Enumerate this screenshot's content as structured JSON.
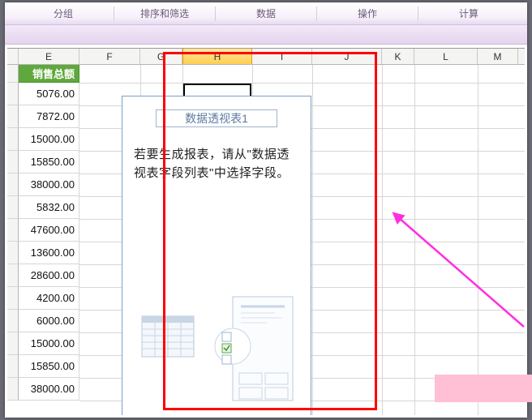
{
  "ribbon": {
    "items": [
      "分组",
      "排序和筛选",
      "数据",
      "操作",
      "计算"
    ]
  },
  "columns": [
    "E",
    "F",
    "G",
    "H",
    "I",
    "J",
    "K",
    "L",
    "M"
  ],
  "active_column": "H",
  "sales_header": "销售总额",
  "sales_values": [
    "5076.00",
    "7872.00",
    "15000.00",
    "15850.00",
    "38000.00",
    "5832.00",
    "47600.00",
    "13600.00",
    "28600.00",
    "4200.00",
    "6000.00",
    "15000.00",
    "15850.00",
    "38000.00"
  ],
  "pivot": {
    "title": "数据透视表1",
    "hint": "若要生成报表，请从\"数据透视表字段列表\"中选择字段。"
  }
}
